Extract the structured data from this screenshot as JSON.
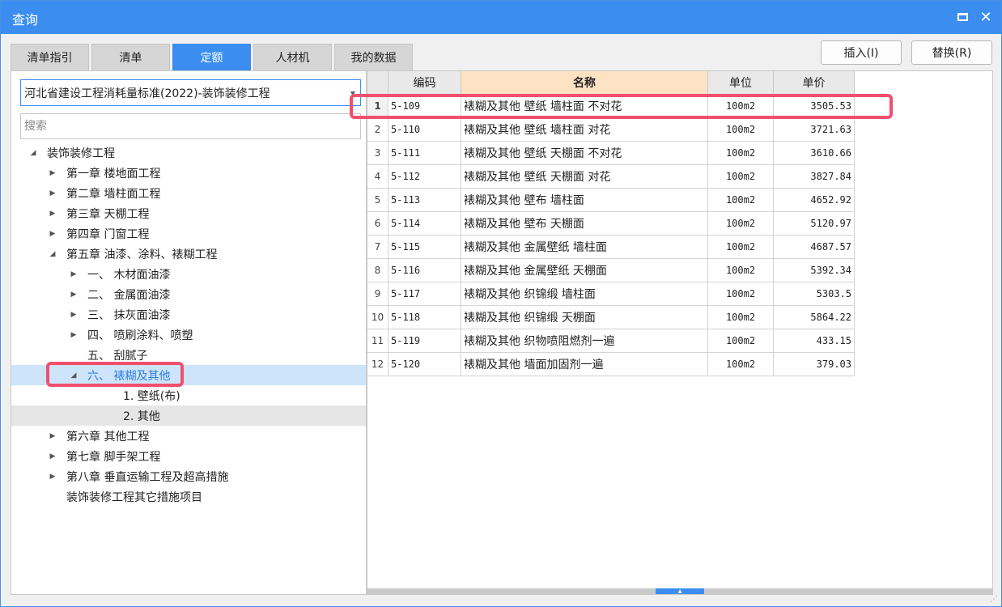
{
  "window": {
    "title": "查询"
  },
  "tabs": [
    "清单指引",
    "清单",
    "定额",
    "人材机",
    "我的数据"
  ],
  "active_tab": 2,
  "toolbar": {
    "insert_label": "插入(I)",
    "replace_label": "替换(R)"
  },
  "left": {
    "standard_select": "河北省建设工程消耗量标准(2022)-装饰装修工程",
    "search_placeholder": "搜索",
    "tree": [
      {
        "label": "装饰装修工程",
        "toggle": "◢"
      },
      {
        "label": "第一章 楼地面工程",
        "toggle": "▶"
      },
      {
        "label": "第二章 墙柱面工程",
        "toggle": "▶"
      },
      {
        "label": "第三章 天棚工程",
        "toggle": "▶"
      },
      {
        "label": "第四章 门窗工程",
        "toggle": "▶"
      },
      {
        "label": "第五章 油漆、涂料、裱糊工程",
        "toggle": "◢"
      },
      {
        "label": "一、 木材面油漆",
        "toggle": "▶"
      },
      {
        "label": "二、 金属面油漆",
        "toggle": "▶"
      },
      {
        "label": "三、 抹灰面油漆",
        "toggle": "▶"
      },
      {
        "label": "四、 喷刷涂料、喷塑",
        "toggle": "▶"
      },
      {
        "label": "五、 刮腻子",
        "toggle": ""
      },
      {
        "label": "六、 裱糊及其他",
        "toggle": "◢"
      },
      {
        "label": "1. 壁纸(布)",
        "toggle": ""
      },
      {
        "label": "2. 其他",
        "toggle": ""
      },
      {
        "label": "第六章 其他工程",
        "toggle": "▶"
      },
      {
        "label": "第七章 脚手架工程",
        "toggle": "▶"
      },
      {
        "label": "第八章 垂直运输工程及超高措施",
        "toggle": "▶"
      },
      {
        "label": "装饰装修工程其它措施项目",
        "toggle": ""
      }
    ]
  },
  "table": {
    "columns": [
      "",
      "编码",
      "名称",
      "单位",
      "单价"
    ],
    "rows": [
      {
        "no": "1",
        "code": "5-109",
        "name": "裱糊及其他 壁纸 墙柱面 不对花",
        "unit": "100m2",
        "price": "3505.53"
      },
      {
        "no": "2",
        "code": "5-110",
        "name": "裱糊及其他 壁纸 墙柱面 对花",
        "unit": "100m2",
        "price": "3721.63"
      },
      {
        "no": "3",
        "code": "5-111",
        "name": "裱糊及其他 壁纸 天棚面 不对花",
        "unit": "100m2",
        "price": "3610.66"
      },
      {
        "no": "4",
        "code": "5-112",
        "name": "裱糊及其他 壁纸 天棚面 对花",
        "unit": "100m2",
        "price": "3827.84"
      },
      {
        "no": "5",
        "code": "5-113",
        "name": "裱糊及其他 壁布 墙柱面",
        "unit": "100m2",
        "price": "4652.92"
      },
      {
        "no": "6",
        "code": "5-114",
        "name": "裱糊及其他 壁布 天棚面",
        "unit": "100m2",
        "price": "5120.97"
      },
      {
        "no": "7",
        "code": "5-115",
        "name": "裱糊及其他 金属壁纸 墙柱面",
        "unit": "100m2",
        "price": "4687.57"
      },
      {
        "no": "8",
        "code": "5-116",
        "name": "裱糊及其他 金属壁纸 天棚面",
        "unit": "100m2",
        "price": "5392.34"
      },
      {
        "no": "9",
        "code": "5-117",
        "name": "裱糊及其他 织锦缎 墙柱面",
        "unit": "100m2",
        "price": "5303.5"
      },
      {
        "no": "10",
        "code": "5-118",
        "name": "裱糊及其他 织锦缎 天棚面",
        "unit": "100m2",
        "price": "5864.22"
      },
      {
        "no": "11",
        "code": "5-119",
        "name": "裱糊及其他 织物喷阻燃剂一遍",
        "unit": "100m2",
        "price": "433.15"
      },
      {
        "no": "12",
        "code": "5-120",
        "name": "裱糊及其他 墙面加固剂一遍",
        "unit": "100m2",
        "price": "379.03"
      }
    ]
  },
  "colors": {
    "accent": "#3b8ef0",
    "highlight": "#f0506e",
    "header_active": "#fde2c4",
    "selected_row": "#cde4fb"
  }
}
